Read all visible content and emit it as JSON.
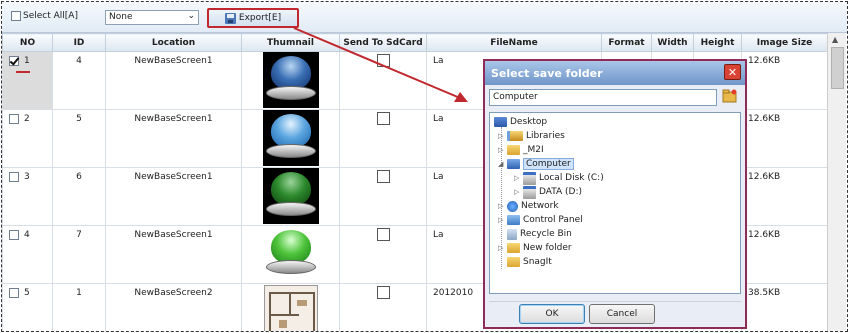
{
  "toolbar": {
    "select_all_label": "Select All[A]",
    "filter_value": "None",
    "export_label": "Export[E]"
  },
  "grid": {
    "columns": [
      "NO",
      "ID",
      "Location",
      "Thumnail",
      "Send To SdCard",
      "FileName",
      "Format",
      "Width",
      "Height",
      "Image Size"
    ],
    "rows": [
      {
        "no": "1",
        "id": "4",
        "location": "NewBaseScreen1",
        "filename": "La",
        "size": "12.6KB",
        "checked": true
      },
      {
        "no": "2",
        "id": "5",
        "location": "NewBaseScreen1",
        "filename": "La",
        "size": "12.6KB",
        "checked": false
      },
      {
        "no": "3",
        "id": "6",
        "location": "NewBaseScreen1",
        "filename": "La",
        "size": "12.6KB",
        "checked": false
      },
      {
        "no": "4",
        "id": "7",
        "location": "NewBaseScreen1",
        "filename": "La",
        "size": "12.6KB",
        "checked": false
      },
      {
        "no": "5",
        "id": "1",
        "location": "NewBaseScreen2",
        "filename": "2012010",
        "size": "38.5KB",
        "checked": false
      }
    ]
  },
  "dialog": {
    "title": "Select save folder",
    "path_value": "Computer",
    "tree": {
      "desktop": "Desktop",
      "libraries": "Libraries",
      "m2i": "_M2I",
      "computer": "Computer",
      "local_disk": "Local Disk (C:)",
      "data_disk": "DATA (D:)",
      "network": "Network",
      "control_panel": "Control Panel",
      "recycle_bin": "Recycle Bin",
      "new_folder": "New folder",
      "snagit": "SnagIt"
    },
    "ok_label": "OK",
    "cancel_label": "Cancel"
  },
  "colors": {
    "highlight_red": "#c0282e",
    "dialog_border": "#8e2b56",
    "title_bar": "#6f95c8"
  }
}
